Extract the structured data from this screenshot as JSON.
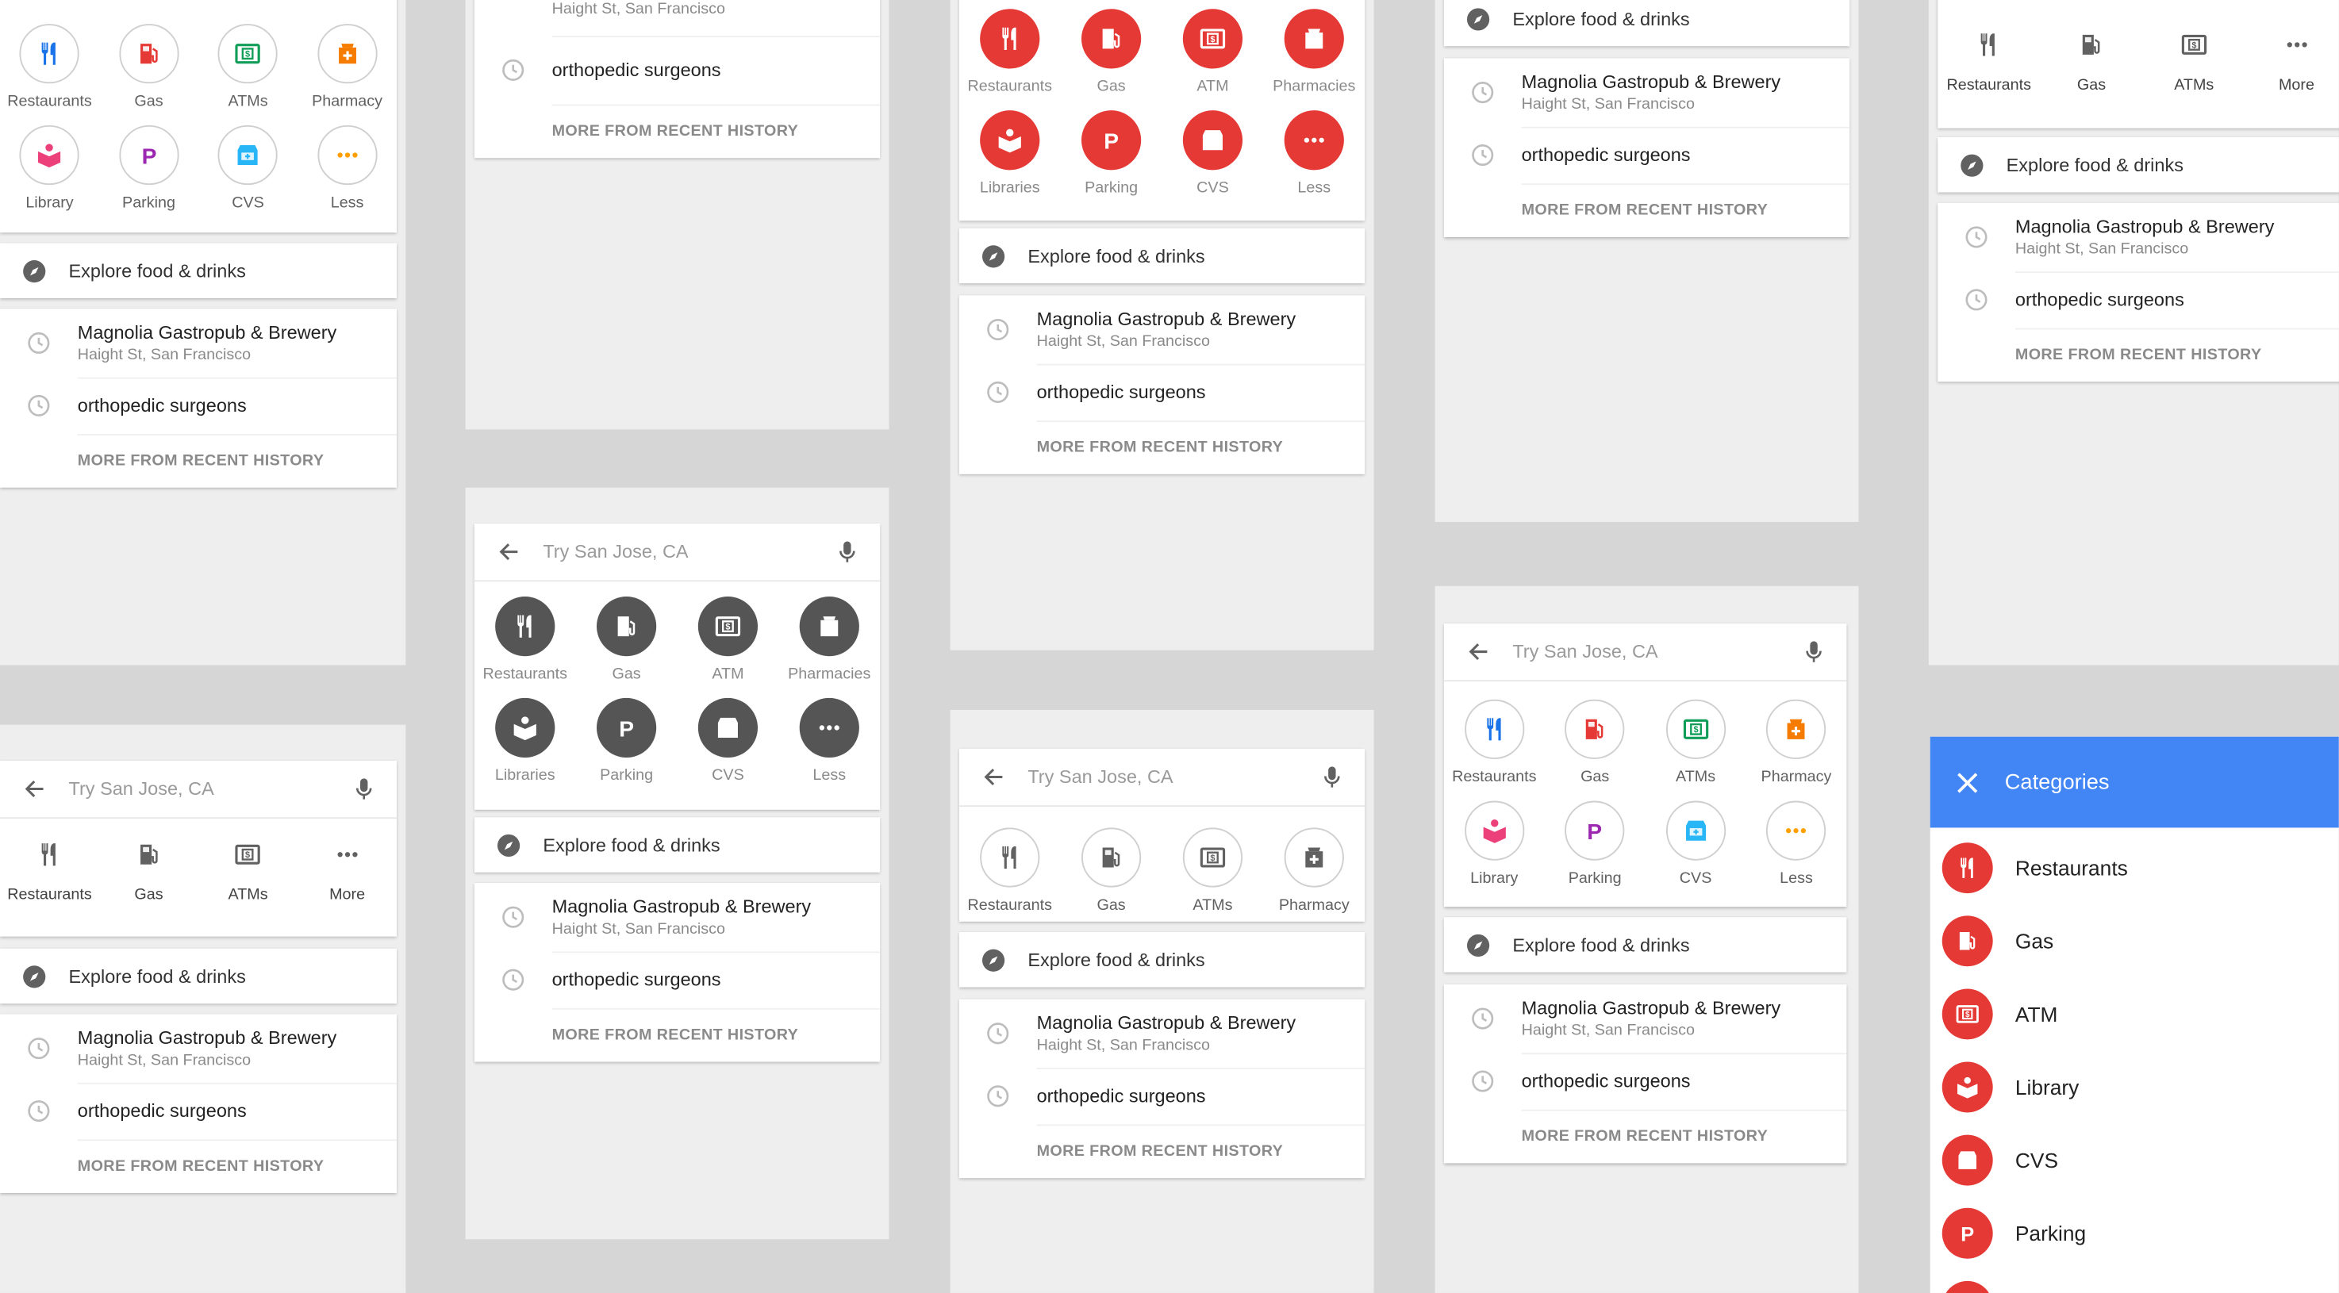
{
  "search": {
    "placeholder": "Try San Jose, CA"
  },
  "explore_label": "Explore food & drinks",
  "history": {
    "item1_title": "Magnolia Gastropub & Brewery",
    "item1_sub": "Haight St, San Francisco",
    "item2_title": "orthopedic surgeons",
    "more": "MORE FROM RECENT HISTORY"
  },
  "variant_a": {
    "cats": [
      {
        "label": "Restaurants",
        "icon": "restaurant-icon",
        "color": "#1a73e8"
      },
      {
        "label": "Gas",
        "icon": "gas-icon",
        "color": "#e53935"
      },
      {
        "label": "ATMs",
        "icon": "atm-icon",
        "color": "#0f9d58"
      },
      {
        "label": "Pharmacy",
        "icon": "pharmacy-icon",
        "color": "#f57c00"
      },
      {
        "label": "Library",
        "icon": "library-icon",
        "color": "#ec407a"
      },
      {
        "label": "Parking",
        "icon": "parking-icon",
        "color": "#9c27b0"
      },
      {
        "label": "CVS",
        "icon": "cvs-icon",
        "color": "#29b6f6"
      },
      {
        "label": "Less",
        "icon": "more-dots-icon",
        "color": "#ffa000"
      }
    ]
  },
  "variant_b": {
    "cats": [
      {
        "label": "Restaurants",
        "icon": "restaurant-icon"
      },
      {
        "label": "Gas",
        "icon": "gas-icon"
      },
      {
        "label": "ATM",
        "icon": "atm-icon"
      },
      {
        "label": "Pharmacies",
        "icon": "pharmacy-icon"
      },
      {
        "label": "Libraries",
        "icon": "library-icon"
      },
      {
        "label": "Parking",
        "icon": "parking-icon"
      },
      {
        "label": "CVS",
        "icon": "cvs-icon"
      },
      {
        "label": "Less",
        "icon": "more-dots-icon"
      }
    ],
    "gray": "#555555",
    "red": "#e53935"
  },
  "variant_c": {
    "cats": [
      {
        "label": "Restaurants",
        "icon": "restaurant-icon"
      },
      {
        "label": "Gas",
        "icon": "gas-icon"
      },
      {
        "label": "ATMs",
        "icon": "atm-icon"
      },
      {
        "label": "More",
        "icon": "more-dots-icon"
      }
    ]
  },
  "variant_d": {
    "cats": [
      {
        "label": "Restaurants",
        "icon": "restaurant-icon"
      },
      {
        "label": "Gas",
        "icon": "gas-icon"
      },
      {
        "label": "ATMs",
        "icon": "atm-icon"
      },
      {
        "label": "Pharmacy",
        "icon": "pharmacy-icon"
      }
    ]
  },
  "categories_panel": {
    "title": "Categories",
    "items": [
      "Restaurants",
      "Gas",
      "ATM",
      "Library",
      "CVS",
      "Parking"
    ],
    "accent": "#4285f4",
    "red": "#e53935"
  }
}
